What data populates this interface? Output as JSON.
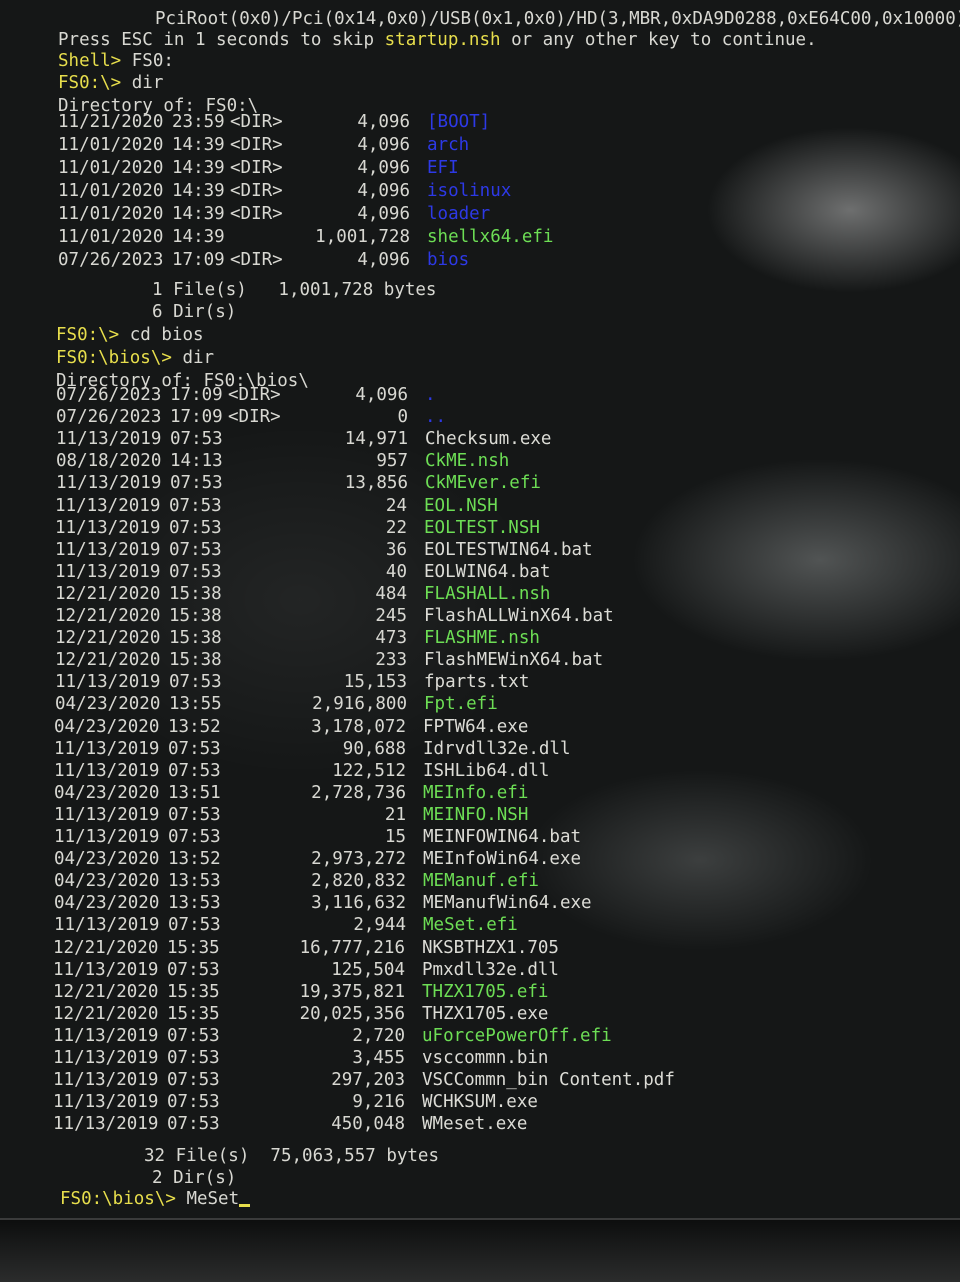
{
  "header": {
    "path_line": "PciRoot(0x0)/Pci(0x14,0x0)/USB(0x1,0x0)/HD(3,MBR,0xDA9D0288,0xE64C00,0x10000)",
    "press_esc_pre": "Press ESC in 1 seconds to skip ",
    "startup_script": "startup.nsh",
    "press_esc_post": " or any other key to continue.",
    "shell_prompt": "Shell> ",
    "shell_cmd": "FS0:"
  },
  "listing1": {
    "prompt": "FS0:\\> ",
    "command": "dir",
    "directory_of": "Directory of: FS0:\\",
    "entries": [
      {
        "date": "11/21/2020",
        "time": "23:59",
        "dir": "<DIR>",
        "size": "4,096",
        "name": "[BOOT]",
        "kind": "dir"
      },
      {
        "date": "11/01/2020",
        "time": "14:39",
        "dir": "<DIR>",
        "size": "4,096",
        "name": "arch",
        "kind": "dir"
      },
      {
        "date": "11/01/2020",
        "time": "14:39",
        "dir": "<DIR>",
        "size": "4,096",
        "name": "EFI",
        "kind": "dir"
      },
      {
        "date": "11/01/2020",
        "time": "14:39",
        "dir": "<DIR>",
        "size": "4,096",
        "name": "isolinux",
        "kind": "dir"
      },
      {
        "date": "11/01/2020",
        "time": "14:39",
        "dir": "<DIR>",
        "size": "4,096",
        "name": "loader",
        "kind": "dir"
      },
      {
        "date": "11/01/2020",
        "time": "14:39",
        "dir": "",
        "size": "1,001,728",
        "name": "shellx64.efi",
        "kind": "exec"
      },
      {
        "date": "07/26/2023",
        "time": "17:09",
        "dir": "<DIR>",
        "size": "4,096",
        "name": "bios",
        "kind": "dir"
      }
    ],
    "files_summary": "1 File(s)   1,001,728 bytes",
    "dirs_summary": "6 Dir(s)"
  },
  "cd_command": {
    "prompt": "FS0:\\> ",
    "command": "cd bios"
  },
  "listing2": {
    "prompt": "FS0:\\bios\\> ",
    "command": "dir",
    "directory_of": "Directory of: FS0:\\bios\\",
    "entries": [
      {
        "date": "07/26/2023",
        "time": "17:09",
        "dir": "<DIR>",
        "size": "4,096",
        "name": ".",
        "kind": "dir"
      },
      {
        "date": "07/26/2023",
        "time": "17:09",
        "dir": "<DIR>",
        "size": "0",
        "name": "..",
        "kind": "dir"
      },
      {
        "date": "11/13/2019",
        "time": "07:53",
        "dir": "",
        "size": "14,971",
        "name": "Checksum.exe",
        "kind": "file"
      },
      {
        "date": "08/18/2020",
        "time": "14:13",
        "dir": "",
        "size": "957",
        "name": "CkME.nsh",
        "kind": "exec"
      },
      {
        "date": "11/13/2019",
        "time": "07:53",
        "dir": "",
        "size": "13,856",
        "name": "CkMEver.efi",
        "kind": "exec"
      },
      {
        "date": "11/13/2019",
        "time": "07:53",
        "dir": "",
        "size": "24",
        "name": "EOL.NSH",
        "kind": "exec"
      },
      {
        "date": "11/13/2019",
        "time": "07:53",
        "dir": "",
        "size": "22",
        "name": "EOLTEST.NSH",
        "kind": "exec"
      },
      {
        "date": "11/13/2019",
        "time": "07:53",
        "dir": "",
        "size": "36",
        "name": "EOLTESTWIN64.bat",
        "kind": "file"
      },
      {
        "date": "11/13/2019",
        "time": "07:53",
        "dir": "",
        "size": "40",
        "name": "EOLWIN64.bat",
        "kind": "file"
      },
      {
        "date": "12/21/2020",
        "time": "15:38",
        "dir": "",
        "size": "484",
        "name": "FLASHALL.nsh",
        "kind": "exec"
      },
      {
        "date": "12/21/2020",
        "time": "15:38",
        "dir": "",
        "size": "245",
        "name": "FlashALLWinX64.bat",
        "kind": "file"
      },
      {
        "date": "12/21/2020",
        "time": "15:38",
        "dir": "",
        "size": "473",
        "name": "FLASHME.nsh",
        "kind": "exec"
      },
      {
        "date": "12/21/2020",
        "time": "15:38",
        "dir": "",
        "size": "233",
        "name": "FlashMEWinX64.bat",
        "kind": "file"
      },
      {
        "date": "11/13/2019",
        "time": "07:53",
        "dir": "",
        "size": "15,153",
        "name": "fparts.txt",
        "kind": "file"
      },
      {
        "date": "04/23/2020",
        "time": "13:55",
        "dir": "",
        "size": "2,916,800",
        "name": "Fpt.efi",
        "kind": "exec"
      },
      {
        "date": "04/23/2020",
        "time": "13:52",
        "dir": "",
        "size": "3,178,072",
        "name": "FPTW64.exe",
        "kind": "file"
      },
      {
        "date": "11/13/2019",
        "time": "07:53",
        "dir": "",
        "size": "90,688",
        "name": "Idrvdll32e.dll",
        "kind": "file"
      },
      {
        "date": "11/13/2019",
        "time": "07:53",
        "dir": "",
        "size": "122,512",
        "name": "ISHLib64.dll",
        "kind": "file"
      },
      {
        "date": "04/23/2020",
        "time": "13:51",
        "dir": "",
        "size": "2,728,736",
        "name": "MEInfo.efi",
        "kind": "exec"
      },
      {
        "date": "11/13/2019",
        "time": "07:53",
        "dir": "",
        "size": "21",
        "name": "MEINFO.NSH",
        "kind": "exec"
      },
      {
        "date": "11/13/2019",
        "time": "07:53",
        "dir": "",
        "size": "15",
        "name": "MEINFOWIN64.bat",
        "kind": "file"
      },
      {
        "date": "04/23/2020",
        "time": "13:52",
        "dir": "",
        "size": "2,973,272",
        "name": "MEInfoWin64.exe",
        "kind": "file"
      },
      {
        "date": "04/23/2020",
        "time": "13:53",
        "dir": "",
        "size": "2,820,832",
        "name": "MEManuf.efi",
        "kind": "exec"
      },
      {
        "date": "04/23/2020",
        "time": "13:53",
        "dir": "",
        "size": "3,116,632",
        "name": "MEManufWin64.exe",
        "kind": "file"
      },
      {
        "date": "11/13/2019",
        "time": "07:53",
        "dir": "",
        "size": "2,944",
        "name": "MeSet.efi",
        "kind": "exec"
      },
      {
        "date": "12/21/2020",
        "time": "15:35",
        "dir": "",
        "size": "16,777,216",
        "name": "NKSBTHZX1.705",
        "kind": "file"
      },
      {
        "date": "11/13/2019",
        "time": "07:53",
        "dir": "",
        "size": "125,504",
        "name": "Pmxdll32e.dll",
        "kind": "file"
      },
      {
        "date": "12/21/2020",
        "time": "15:35",
        "dir": "",
        "size": "19,375,821",
        "name": "THZX1705.efi",
        "kind": "exec"
      },
      {
        "date": "12/21/2020",
        "time": "15:35",
        "dir": "",
        "size": "20,025,356",
        "name": "THZX1705.exe",
        "kind": "file"
      },
      {
        "date": "11/13/2019",
        "time": "07:53",
        "dir": "",
        "size": "2,720",
        "name": "uForcePowerOff.efi",
        "kind": "exec"
      },
      {
        "date": "11/13/2019",
        "time": "07:53",
        "dir": "",
        "size": "3,455",
        "name": "vsccommn.bin",
        "kind": "file"
      },
      {
        "date": "11/13/2019",
        "time": "07:53",
        "dir": "",
        "size": "297,203",
        "name": "VSCCommn_bin Content.pdf",
        "kind": "file"
      },
      {
        "date": "11/13/2019",
        "time": "07:53",
        "dir": "",
        "size": "9,216",
        "name": "WCHKSUM.exe",
        "kind": "file"
      },
      {
        "date": "11/13/2019",
        "time": "07:53",
        "dir": "",
        "size": "450,048",
        "name": "WMeset.exe",
        "kind": "file"
      }
    ],
    "files_summary": "32 File(s)  75,063,557 bytes",
    "dirs_summary": "2 Dir(s)"
  },
  "final_prompt": {
    "prompt": "FS0:\\bios\\> ",
    "typed": "MeSet"
  },
  "colors": {
    "prompt": "#e7de4c",
    "executable": "#6dde55",
    "directory": "#2d39e6",
    "text": "#d8d8d2"
  }
}
